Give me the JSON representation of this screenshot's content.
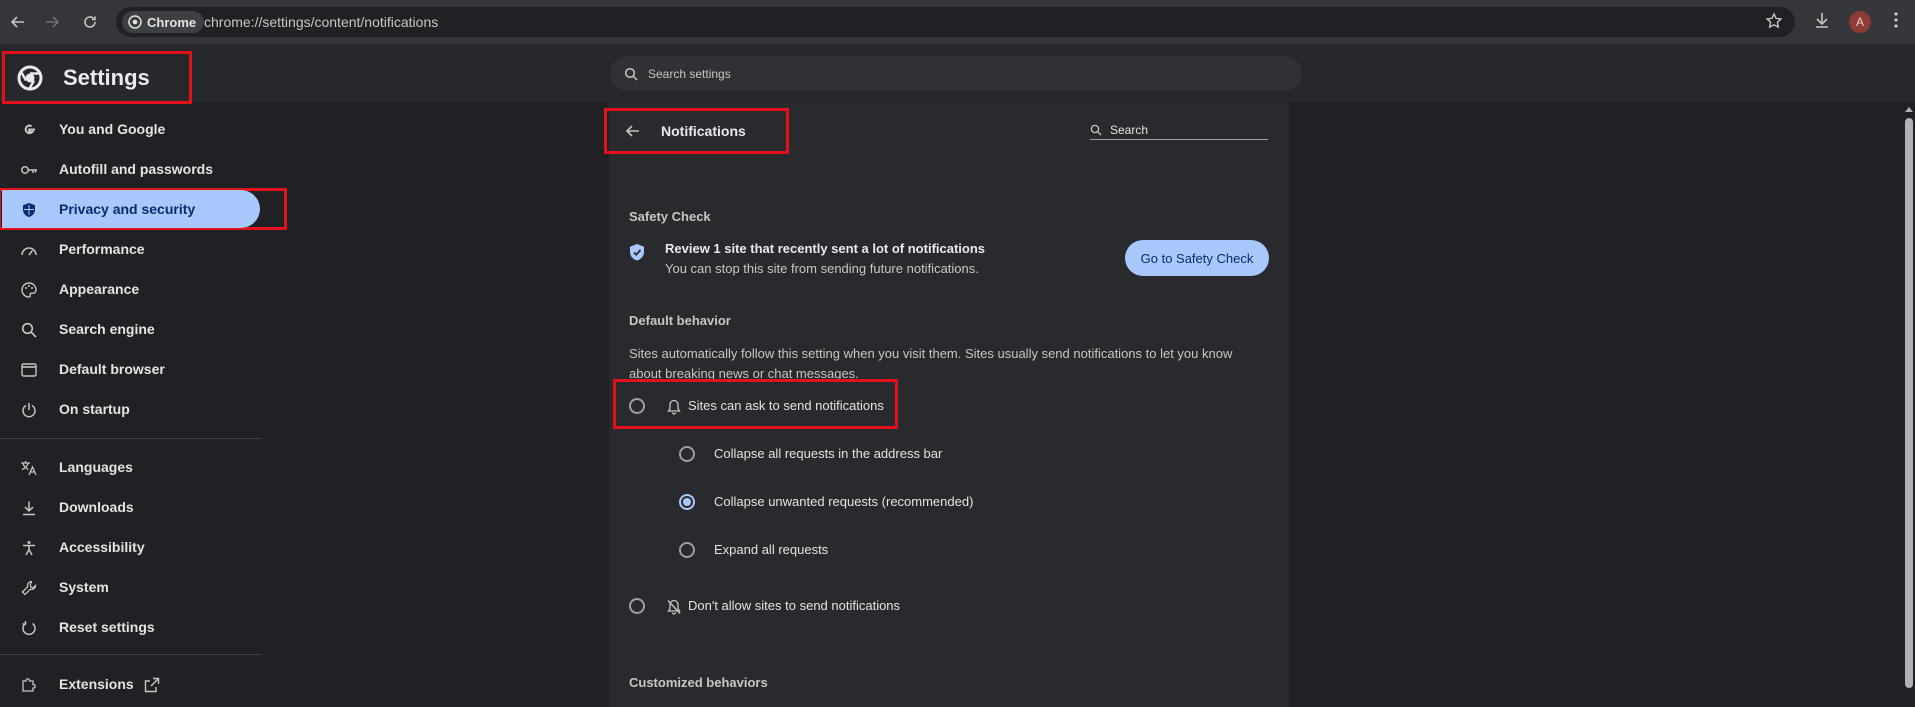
{
  "browser": {
    "chip_label": "Chrome",
    "url": "chrome://settings/content/notifications",
    "avatar_letter": "A"
  },
  "header": {
    "title": "Settings",
    "search_placeholder": "Search settings"
  },
  "sidebar": {
    "items": [
      {
        "label": "You and Google",
        "icon": "google-icon"
      },
      {
        "label": "Autofill and passwords",
        "icon": "key-icon"
      },
      {
        "label": "Privacy and security",
        "icon": "shield-icon",
        "active": true
      },
      {
        "label": "Performance",
        "icon": "speedometer-icon"
      },
      {
        "label": "Appearance",
        "icon": "palette-icon"
      },
      {
        "label": "Search engine",
        "icon": "search-icon"
      },
      {
        "label": "Default browser",
        "icon": "browser-window-icon"
      },
      {
        "label": "On startup",
        "icon": "power-icon"
      },
      {
        "label": "Languages",
        "icon": "translate-icon"
      },
      {
        "label": "Downloads",
        "icon": "download-icon"
      },
      {
        "label": "Accessibility",
        "icon": "accessibility-icon"
      },
      {
        "label": "System",
        "icon": "wrench-icon"
      },
      {
        "label": "Reset settings",
        "icon": "reset-icon"
      },
      {
        "label": "Extensions",
        "icon": "puzzle-icon"
      }
    ]
  },
  "main": {
    "title": "Notifications",
    "search_label": "Search",
    "safety_check": {
      "heading": "Safety Check",
      "title": "Review 1 site that recently sent a lot of notifications",
      "subtitle": "You can stop this site from sending future notifications.",
      "button": "Go to Safety Check"
    },
    "default_behavior": {
      "heading": "Default behavior",
      "description": "Sites automatically follow this setting when you visit them. Sites usually send notifications to let you know about breaking news or chat messages.",
      "option_ask": "Sites can ask to send notifications",
      "sub_options": [
        {
          "label": "Collapse all requests in the address bar",
          "checked": false
        },
        {
          "label": "Collapse unwanted requests (recommended)",
          "checked": true
        },
        {
          "label": "Expand all requests",
          "checked": false
        }
      ],
      "option_block": "Don't allow sites to send notifications"
    },
    "customized_heading": "Customized behaviors"
  },
  "colors": {
    "accent": "#a8c7fa",
    "highlight": "#e3111c",
    "background": "#202124"
  }
}
